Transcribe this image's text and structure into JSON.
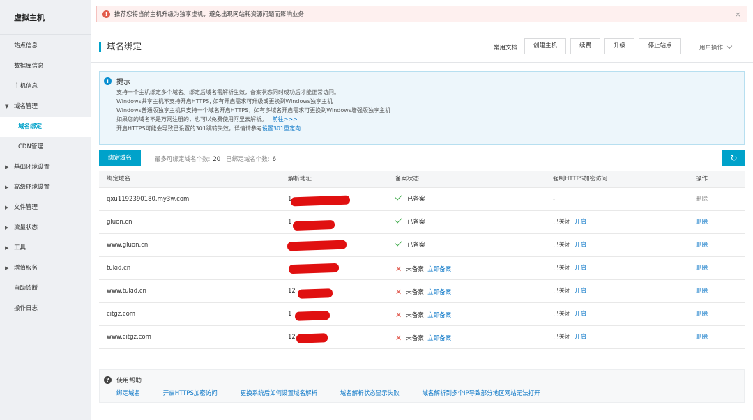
{
  "sidebar": {
    "title": "虚拟主机",
    "items": [
      {
        "label": "站点信息",
        "type": "item"
      },
      {
        "label": "数据库信息",
        "type": "item"
      },
      {
        "label": "主机信息",
        "type": "item"
      },
      {
        "label": "域名管理",
        "type": "group",
        "expanded": true
      },
      {
        "label": "域名绑定",
        "type": "sub",
        "active": true
      },
      {
        "label": "CDN管理",
        "type": "sub"
      },
      {
        "label": "基础环境设置",
        "type": "group"
      },
      {
        "label": "高级环境设置",
        "type": "group"
      },
      {
        "label": "文件管理",
        "type": "group"
      },
      {
        "label": "流量状态",
        "type": "group"
      },
      {
        "label": "工具",
        "type": "group"
      },
      {
        "label": "增值服务",
        "type": "group"
      },
      {
        "label": "自助诊断",
        "type": "item"
      },
      {
        "label": "操作日志",
        "type": "item"
      }
    ]
  },
  "alert": {
    "icon": "warning-icon",
    "text": "推荐您将当前主机升级为独享虚机，避免出现网站耗资源问题而影响业务"
  },
  "header": {
    "title": "域名绑定",
    "doc_link": "常用文档",
    "buttons": {
      "create": "创建主机",
      "renew": "续费",
      "upgrade": "升级",
      "stop": "停止站点"
    },
    "user_ops": "用户操作"
  },
  "tip": {
    "title": "提示",
    "lines": [
      "支持一个主机绑定多个域名。绑定后域名需解析生效，备案状态同时成功后才能正常访问。",
      "Windows共享主机不支持开启HTTPS, 如有开启需求可升级或更换到Windows独享主机",
      "Windows普通版独享主机只支持一个域名开启HTTPS，如有多域名开启需求可更换到Windows增强版独享主机",
      "如果您的域名不是万网注册的，也可以免费使用阿里云解析。"
    ],
    "line4_link": "前往>>>",
    "line5_text": "开启HTTPS可能会导致已设置的301跳转失效，详情请参考",
    "line5_link": "设置301重定向"
  },
  "toolbar": {
    "bind_button": "绑定域名",
    "max_label": "最多可绑定域名个数:",
    "max_value": "20",
    "bound_label": "已绑定域名个数:",
    "bound_value": "6"
  },
  "table": {
    "headers": [
      "绑定域名",
      "解析地址",
      "备案状态",
      "强制HTTPS加密访问",
      "操作"
    ],
    "rows": [
      {
        "domain": "qxu1192390180.my3w.com",
        "ip": "1",
        "filed": true,
        "status": "已备案",
        "file_link": "",
        "https": "-",
        "https_link": "",
        "action": "删除",
        "action_enabled": false
      },
      {
        "domain": "gluon.cn",
        "ip": "1",
        "filed": true,
        "status": "已备案",
        "file_link": "",
        "https": "已关闭",
        "https_link": "开启",
        "action": "删除",
        "action_enabled": true
      },
      {
        "domain": "www.gluon.cn",
        "ip": "",
        "filed": true,
        "status": "已备案",
        "file_link": "",
        "https": "已关闭",
        "https_link": "开启",
        "action": "删除",
        "action_enabled": true
      },
      {
        "domain": "tukid.cn",
        "ip": "",
        "filed": false,
        "status": "未备案",
        "file_link": "立即备案",
        "https": "已关闭",
        "https_link": "开启",
        "action": "删除",
        "action_enabled": true
      },
      {
        "domain": "www.tukid.cn",
        "ip": "12",
        "filed": false,
        "status": "未备案",
        "file_link": "立即备案",
        "https": "已关闭",
        "https_link": "开启",
        "action": "删除",
        "action_enabled": true
      },
      {
        "domain": "citgz.com",
        "ip": "1",
        "filed": false,
        "status": "未备案",
        "file_link": "立即备案",
        "https": "已关闭",
        "https_link": "开启",
        "action": "删除",
        "action_enabled": true
      },
      {
        "domain": "www.citgz.com",
        "ip": "12",
        "filed": false,
        "status": "未备案",
        "file_link": "立即备案",
        "https": "已关闭",
        "https_link": "开启",
        "action": "删除",
        "action_enabled": true
      }
    ]
  },
  "help": {
    "title": "使用帮助",
    "links": [
      "绑定域名",
      "开启HTTPS加密访问",
      "更换系统后如何设置域名解析",
      "域名解析状态显示失败",
      "域名解析到多个IP导致部分地区网站无法打开"
    ]
  },
  "colors": {
    "accent": "#00a2ca",
    "link": "#0a76c7",
    "success": "#3eaa4a",
    "error": "#e05a4f",
    "redaction": "#e01010"
  }
}
